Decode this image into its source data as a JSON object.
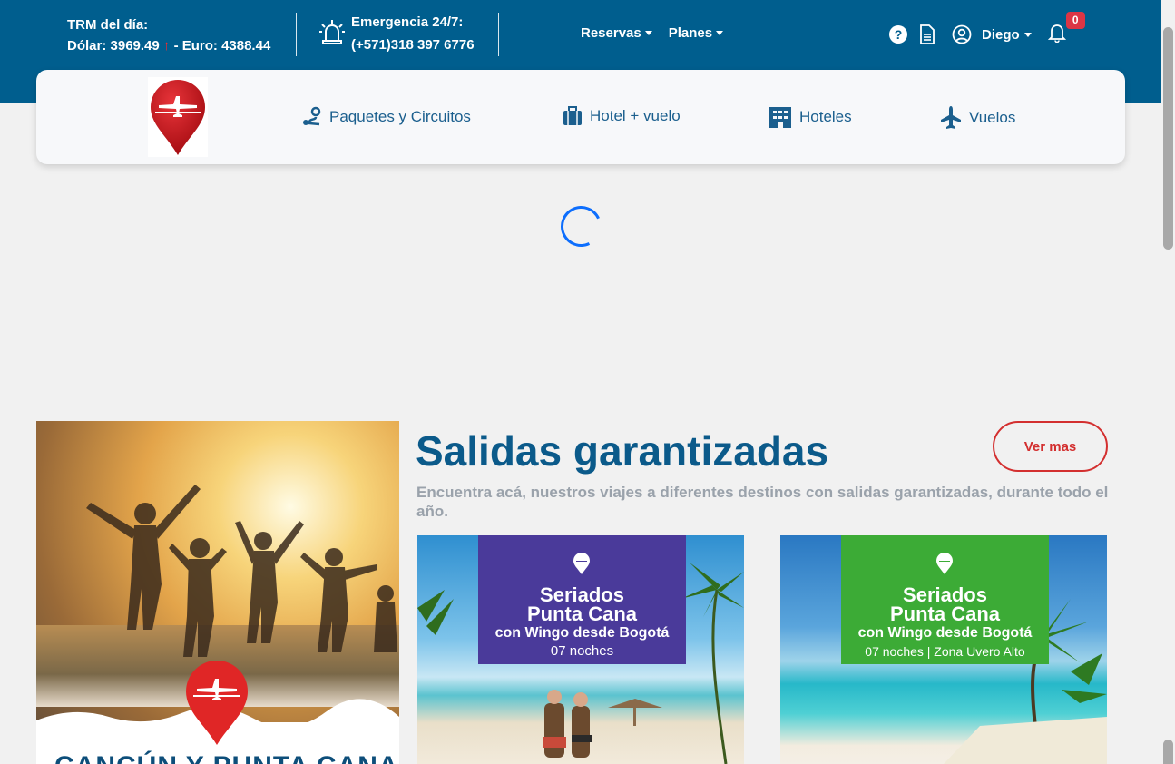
{
  "header": {
    "trm_label": "TRM del día:",
    "dolar": "Dólar: 3969.49",
    "dolar_arrow": "↑",
    "euro": " - Euro: 4388.44",
    "emergency_label": "Emergencia 24/7:",
    "emergency_phone": "(+571)318 397 6776",
    "menus": [
      "Reservas",
      "Planes"
    ],
    "user_name": "Diego",
    "notifications_count": "0",
    "icons": [
      "help-icon",
      "document-icon",
      "user-icon",
      "bell-icon"
    ]
  },
  "nav": {
    "items": [
      {
        "label": "Paquetes y Circuitos",
        "icon": "route-icon"
      },
      {
        "label": "Hotel + vuelo",
        "icon": "luggage-icon"
      },
      {
        "label": "Hoteles",
        "icon": "building-icon"
      },
      {
        "label": "Vuelos",
        "icon": "plane-icon"
      }
    ]
  },
  "promo": {
    "title": "CANCÚN Y PUNTA CANA"
  },
  "section": {
    "title": "Salidas garantizadas",
    "button": "Ver mas",
    "description": "Encuentra acá, nuestros viajes a diferentes destinos con salidas garantizadas, durante todo el año."
  },
  "cards": [
    {
      "line1": "Seriados",
      "line2": "Punta Cana",
      "line3": "con Wingo desde Bogotá",
      "line4": "07 noches",
      "panel_color": "#4a3a9a"
    },
    {
      "line1": "Seriados",
      "line2": "Punta Cana",
      "line3": "con Wingo desde Bogotá",
      "line4": "07 noches | Zona Uvero Alto",
      "panel_color": "#3cab36"
    }
  ],
  "colors": {
    "brand_blue": "#005e8e",
    "accent_red": "#d32f2f",
    "nav_text": "#1b5f8e"
  }
}
